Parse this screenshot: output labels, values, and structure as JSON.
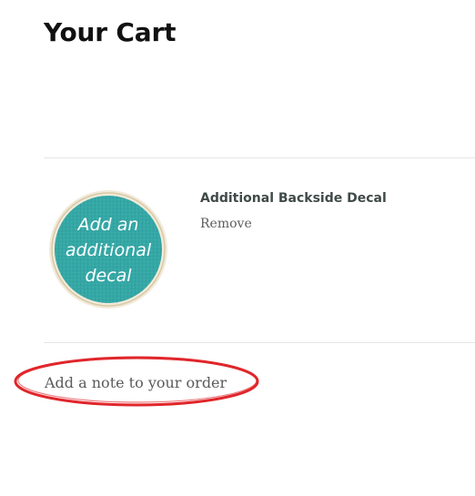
{
  "page": {
    "title": "Your Cart"
  },
  "cart": {
    "items": [
      {
        "title": "Additional Backside Decal",
        "remove_label": "Remove",
        "image": {
          "text_lines": [
            "Add an",
            "additional",
            "decal"
          ],
          "colors": {
            "fill": "#35a8a6",
            "rim": "#e8dfc7",
            "text": "#ffffff"
          }
        }
      }
    ]
  },
  "note": {
    "label": "Add a note to your order"
  },
  "annotation": {
    "color": "#e0262b"
  }
}
